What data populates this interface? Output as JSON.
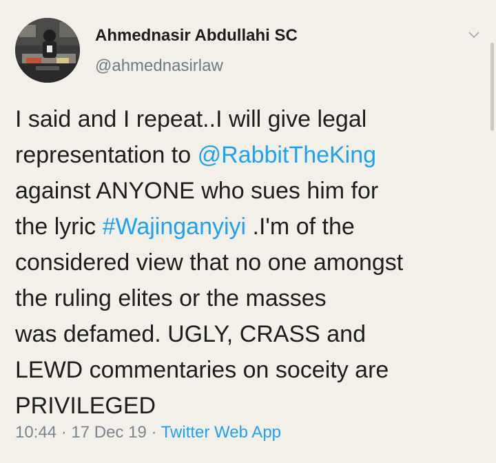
{
  "author": {
    "display_name": "Ahmednasir Abdullahi SC",
    "handle": "@ahmednasirlaw"
  },
  "tweet": {
    "lines": [
      [
        {
          "text": "I said and I repeat..I will give legal"
        }
      ],
      [
        {
          "text": "representation to "
        },
        {
          "text": "@RabbitTheKing",
          "link": true
        }
      ],
      [
        {
          "text": "against ANYONE who sues him for"
        }
      ],
      [
        {
          "text": "the lyric "
        },
        {
          "text": "#Wajinganyiyi",
          "link": true
        },
        {
          "text": " .I'm of the"
        }
      ],
      [
        {
          "text": "considered view that no one amongst"
        }
      ],
      [
        {
          "text": "the ruling elites or the masses"
        }
      ],
      [
        {
          "text": "was defamed. UGLY, CRASS and"
        }
      ],
      [
        {
          "text": "LEWD commentaries on soceity are"
        }
      ],
      [
        {
          "text": "PRIVILEGED"
        }
      ]
    ]
  },
  "meta": {
    "time": "10:44",
    "separator": " · ",
    "date": "17 Dec 19",
    "source": "Twitter Web App"
  },
  "colors": {
    "background": "#f3f0ea",
    "link": "#1da1f2",
    "secondary_text": "#6f7a84"
  },
  "icons": {
    "menu": "chevron-down-icon"
  }
}
